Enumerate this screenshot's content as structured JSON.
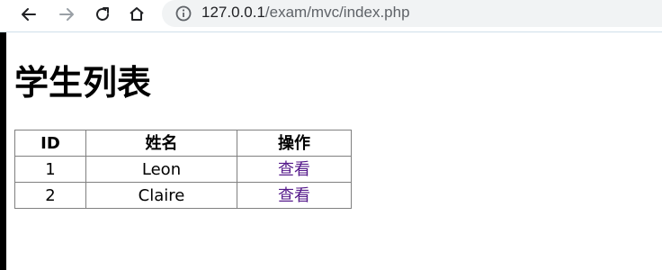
{
  "browser": {
    "url_host": "127.0.0.1",
    "url_path": "/exam/mvc/index.php"
  },
  "page": {
    "title": "学生列表"
  },
  "table": {
    "headers": [
      "ID",
      "姓名",
      "操作"
    ],
    "rows": [
      {
        "id": "1",
        "name": "Leon",
        "action": "查看"
      },
      {
        "id": "2",
        "name": "Claire",
        "action": "查看"
      }
    ]
  },
  "colors": {
    "link_visited": "#551a8b",
    "omnibox_bg": "#f1f3f4"
  }
}
